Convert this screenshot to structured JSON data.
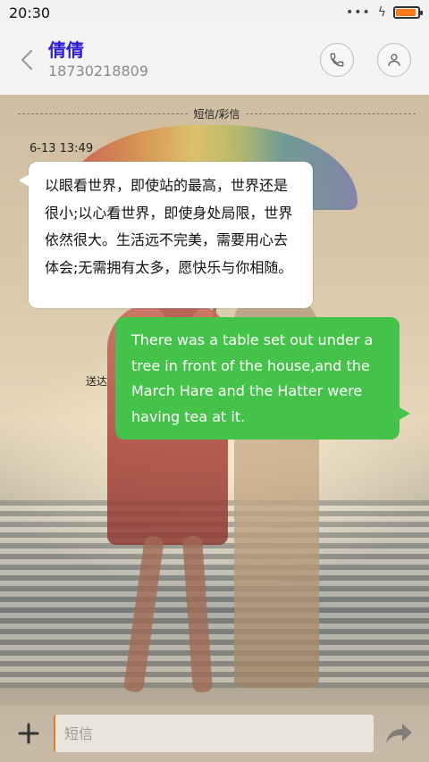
{
  "status_bar": {
    "time": "20:30",
    "icons": [
      "dots-icon",
      "charging-bolt-icon",
      "battery-icon"
    ],
    "battery_fill_fraction": 0.9,
    "battery_color": "#ff7a1a"
  },
  "header": {
    "contact_name": "倩倩",
    "contact_number": "18730218809",
    "back_icon": "chevron-left-icon",
    "call_icon": "phone-icon",
    "profile_icon": "person-icon",
    "name_color": "#2c1bd6"
  },
  "conversation": {
    "channel_label": "短信/彩信",
    "messages": [
      {
        "direction": "incoming",
        "timestamp": "6-13 13:49",
        "text": "以眼看世界，即使站的最高，世界还是很小;以心看世界，即使身处局限，世界依然很大。生活远不完美，需要用心去体会;无需拥有太多，愿快乐与你相随。"
      },
      {
        "direction": "outgoing",
        "status": "送达",
        "text": "There was a table set out under a tree in front of the house,and the March Hare and the Hatter were having tea at it.",
        "bubble_color": "#45c24a"
      }
    ]
  },
  "composer": {
    "placeholder": "短信",
    "value": "",
    "add_icon": "plus-icon",
    "send_icon": "send-arrow-icon"
  }
}
